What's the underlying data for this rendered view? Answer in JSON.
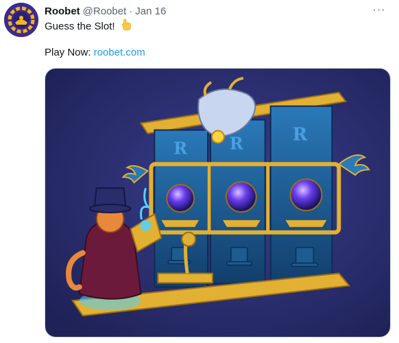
{
  "tweet": {
    "author_name": "Roobet",
    "author_handle": "@Roobet",
    "separator": "·",
    "date": "Jan 16",
    "text_line1": "Guess the Slot!",
    "text_play_prefix": "Play Now: ",
    "link_text": "roobet.com",
    "more_label": "···"
  },
  "icons": {
    "avatar": "roobet-logo-avatar",
    "emoji": "pointing-down-hand-emoji",
    "more": "more-options-icon"
  },
  "media": {
    "description_icon": "slot-game-art-image",
    "reel_symbol_text": "R"
  },
  "colors": {
    "link": "#1d9bf0",
    "text_primary": "#0f1419",
    "text_secondary": "#536471",
    "media_background": "#2a2e6e",
    "gold": "#e2b033",
    "reel_blue": "#1d5e95"
  }
}
